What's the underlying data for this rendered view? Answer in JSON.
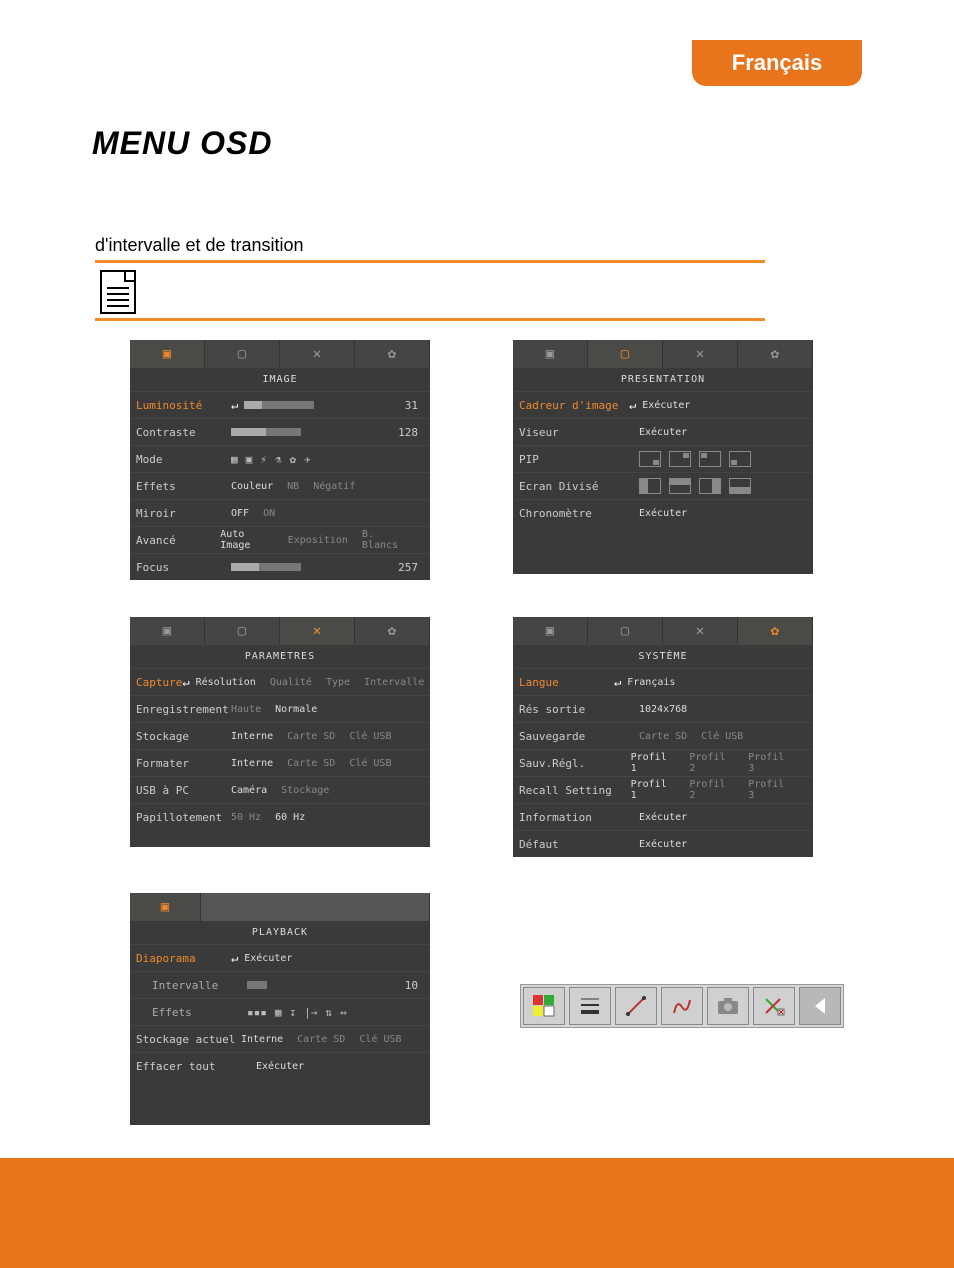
{
  "language_tab": "Français",
  "page_title": "MENU OSD",
  "subtitle": "d'intervalle et de transition",
  "menus": {
    "image": {
      "title": "IMAGE",
      "tabs_active": 0,
      "rows": {
        "luminosite": {
          "label": "Luminosité",
          "value": "31"
        },
        "contraste": {
          "label": "Contraste",
          "value": "128"
        },
        "mode": {
          "label": "Mode"
        },
        "effets": {
          "label": "Effets",
          "opts": [
            "Couleur",
            "NB",
            "Négatif"
          ]
        },
        "miroir": {
          "label": "Miroir",
          "opts": [
            "OFF",
            "ON"
          ]
        },
        "avance": {
          "label": "Avancé",
          "opts": [
            "Auto Image",
            "Exposition",
            "B. Blancs"
          ]
        },
        "focus": {
          "label": "Focus",
          "value": "257"
        }
      }
    },
    "presentation": {
      "title": "PRESENTATION",
      "tabs_active": 1,
      "rows": {
        "cadreur": {
          "label": "Cadreur d'image",
          "value": "Exécuter"
        },
        "viseur": {
          "label": "Viseur",
          "value": "Exécuter"
        },
        "pip": {
          "label": "PIP"
        },
        "ecran_divise": {
          "label": "Ecran Divisé"
        },
        "chronometre": {
          "label": "Chronomètre",
          "value": "Exécuter"
        }
      }
    },
    "parametres": {
      "title": "PARAMETRES",
      "tabs_active": 2,
      "rows": {
        "capture": {
          "label": "Capture",
          "opts": [
            "Résolution",
            "Qualité",
            "Type",
            "Intervalle"
          ]
        },
        "enregistrement": {
          "label": "Enregistrement",
          "opts": [
            "Haute",
            "Normale"
          ]
        },
        "stockage": {
          "label": "Stockage",
          "opts": [
            "Interne",
            "Carte SD",
            "Clé USB"
          ]
        },
        "formater": {
          "label": "Formater",
          "opts": [
            "Interne",
            "Carte SD",
            "Clé USB"
          ]
        },
        "usb_a_pc": {
          "label": "USB à PC",
          "opts": [
            "Caméra",
            "Stockage"
          ]
        },
        "papillotement": {
          "label": "Papillotement",
          "opts": [
            "50 Hz",
            "60 Hz"
          ]
        }
      }
    },
    "systeme": {
      "title": "SYSTÈME",
      "tabs_active": 3,
      "rows": {
        "langue": {
          "label": "Langue",
          "value": "Français"
        },
        "res_sortie": {
          "label": "Rés sortie",
          "value": "1024x768"
        },
        "sauvegarde": {
          "label": "Sauvegarde",
          "opts": [
            "Carte SD",
            "Clé USB"
          ]
        },
        "sauv_regl": {
          "label": "Sauv.Régl.",
          "opts": [
            "Profil 1",
            "Profil 2",
            "Profil 3"
          ]
        },
        "recall_setting": {
          "label": "Recall Setting",
          "opts": [
            "Profil 1",
            "Profil 2",
            "Profil 3"
          ]
        },
        "information": {
          "label": "Information",
          "value": "Exécuter"
        },
        "defaut": {
          "label": "Défaut",
          "value": "Exécuter"
        }
      }
    },
    "playback": {
      "title": "PLAYBACK",
      "tabs_active": 0,
      "rows": {
        "diaporama": {
          "label": "Diaporama",
          "value": "Exécuter"
        },
        "intervalle": {
          "label": "Intervalle",
          "value": "10"
        },
        "effets": {
          "label": "Effets"
        },
        "stockage_actuel": {
          "label": "Stockage actuel",
          "opts": [
            "Interne",
            "Carte SD",
            "Clé USB"
          ]
        },
        "effacer_tout": {
          "label": "Effacer tout",
          "value": "Exécuter"
        }
      }
    }
  }
}
